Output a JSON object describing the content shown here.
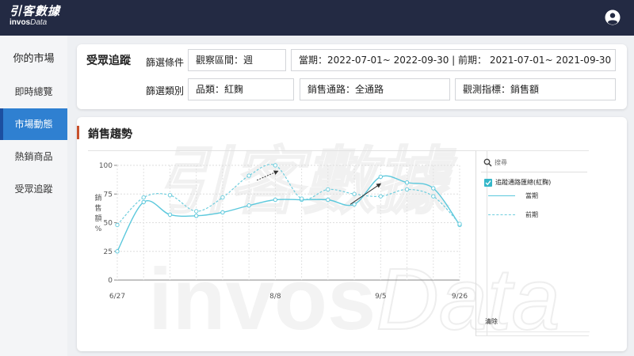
{
  "brand": {
    "name_cn": "引客數據",
    "name_en_bold": "invos",
    "name_en_italic": "Data",
    "watermark_cn": "引客數據",
    "watermark_en_bold": "invos",
    "watermark_en_italic": "Data"
  },
  "header": {
    "user_icon": "user-circle-icon"
  },
  "sidebar": {
    "title": "你的市場",
    "items": [
      {
        "label": "即時總覽",
        "active": false
      },
      {
        "label": "市場動態",
        "active": true
      },
      {
        "label": "熱銷商品",
        "active": false
      },
      {
        "label": "受眾追蹤",
        "active": false
      }
    ]
  },
  "filters": {
    "title": "受眾追蹤",
    "condition_label": "篩選條件",
    "type_label": "篩選類別",
    "interval": "觀察區間：週",
    "period": "當期：2022-07-01~ 2022-09-30 | 前期： 2021-07-01~ 2021-09-30",
    "category": "品類：紅麴",
    "channel": "銷售通路：全通路",
    "metric": "觀測指標：銷售額"
  },
  "chart": {
    "title": "銷售趨勢",
    "accent_color": "#c8512c",
    "legend": {
      "search_placeholder": "搜尋",
      "checkbox_label": "追蹤通路匯總(紅麴)",
      "current_label": "當期",
      "previous_label": "前期",
      "clear_label": "清除"
    }
  },
  "chart_data": {
    "type": "line",
    "title": "銷售趨勢",
    "xlabel": "",
    "ylabel": "銷售額%",
    "ylabel_chars": [
      "銷",
      "售",
      "額",
      "%"
    ],
    "x_tick_labels": [
      "6/27",
      "8/8",
      "9/5",
      "9/26"
    ],
    "x_ticks_at": [
      0,
      6,
      10,
      13
    ],
    "y_ticks": [
      0,
      25,
      50,
      75,
      100
    ],
    "ylim": [
      0,
      100
    ],
    "xlim": [
      0,
      13
    ],
    "grid": true,
    "series": [
      {
        "name": "當期",
        "style": "solid",
        "color": "#5bc8dc",
        "values": [
          25,
          68,
          57,
          56,
          59,
          65,
          70,
          70,
          70,
          66,
          90,
          85,
          80,
          48
        ]
      },
      {
        "name": "前期",
        "style": "dashed",
        "color": "#6fcede",
        "values": [
          48,
          72,
          74,
          60,
          72,
          91,
          100,
          71,
          79,
          75,
          73,
          79,
          73,
          49
        ]
      }
    ],
    "arrows": [
      "trend-arrow-previous",
      "trend-arrow-current"
    ]
  }
}
